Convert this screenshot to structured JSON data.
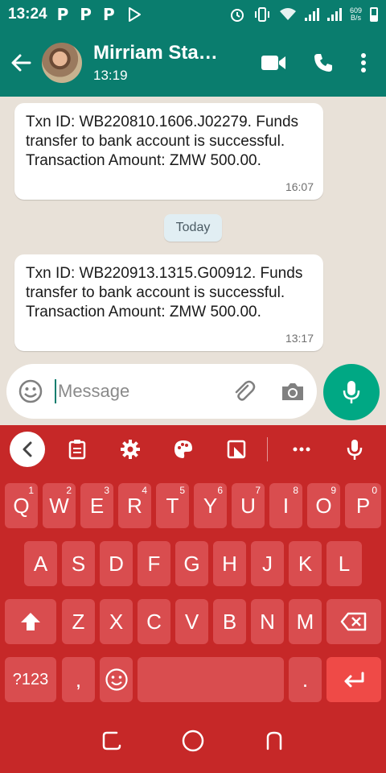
{
  "status_bar": {
    "time": "13:24",
    "notif_icons": [
      "P",
      "P",
      "P"
    ],
    "speed_value": "609",
    "speed_unit": "B/s"
  },
  "header": {
    "contact_name": "Mirriam Sta…",
    "last_seen": "13:19"
  },
  "messages": [
    {
      "text": "Txn ID: WB220810.1606.J02279. Funds transfer to bank account is successful. Transaction Amount: ZMW 500.00.",
      "time": "16:07"
    },
    {
      "text": "Txn ID: WB220913.1315.G00912. Funds transfer to bank account is successful. Transaction Amount: ZMW 500.00.",
      "time": "13:17"
    }
  ],
  "date_chip": "Today",
  "composer": {
    "placeholder": "Message",
    "value": ""
  },
  "keyboard": {
    "row1": [
      {
        "label": "Q",
        "hint": "1"
      },
      {
        "label": "W",
        "hint": "2"
      },
      {
        "label": "E",
        "hint": "3"
      },
      {
        "label": "R",
        "hint": "4"
      },
      {
        "label": "T",
        "hint": "5"
      },
      {
        "label": "Y",
        "hint": "6"
      },
      {
        "label": "U",
        "hint": "7"
      },
      {
        "label": "I",
        "hint": "8"
      },
      {
        "label": "O",
        "hint": "9"
      },
      {
        "label": "P",
        "hint": "0"
      }
    ],
    "row2": [
      "A",
      "S",
      "D",
      "F",
      "G",
      "H",
      "J",
      "K",
      "L"
    ],
    "row3": [
      "Z",
      "X",
      "C",
      "V",
      "B",
      "N",
      "M"
    ],
    "symbols_label": "?123",
    "comma_label": ",",
    "period_label": "."
  },
  "colors": {
    "whatsapp_green": "#0a7d6e",
    "mic_green": "#00a884",
    "keyboard_red": "#c62828",
    "key_red": "#d94d4f",
    "enter_red": "#ef4a47"
  },
  "icons": {
    "back": "arrow-left-icon",
    "video": "video-call-icon",
    "phone": "voice-call-icon",
    "menu": "more-vert-icon",
    "emoji": "emoji-icon",
    "attach": "paperclip-icon",
    "camera": "camera-icon",
    "mic": "mic-icon"
  }
}
